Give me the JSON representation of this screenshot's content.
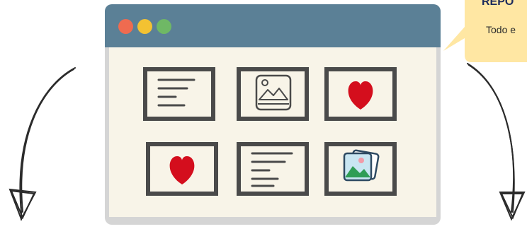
{
  "tooltip": {
    "title": "REPO",
    "text": "Todo e"
  },
  "colors": {
    "titlebar": "#5b8096",
    "content_bg": "#f8f4e8",
    "window_frame": "#d5d5d5",
    "tile_border": "#4a4a4a",
    "heart": "#d40e1d",
    "tooltip_bg": "#ffe7a3",
    "dot_red": "#ef6b50",
    "dot_yellow": "#f3c232",
    "dot_green": "#6fb865"
  },
  "icons": {
    "tile_1": "text-lines-icon",
    "tile_2": "image-icon",
    "tile_3": "heart-icon",
    "tile_4": "heart-icon",
    "tile_5": "text-lines-icon",
    "tile_6": "photo-stack-icon"
  }
}
